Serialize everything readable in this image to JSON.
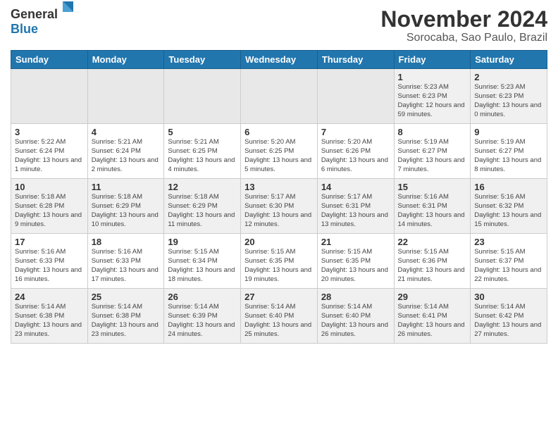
{
  "logo": {
    "general": "General",
    "blue": "Blue"
  },
  "title": {
    "month": "November 2024",
    "location": "Sorocaba, Sao Paulo, Brazil"
  },
  "days_of_week": [
    "Sunday",
    "Monday",
    "Tuesday",
    "Wednesday",
    "Thursday",
    "Friday",
    "Saturday"
  ],
  "weeks": [
    [
      {
        "day": "",
        "empty": true
      },
      {
        "day": "",
        "empty": true
      },
      {
        "day": "",
        "empty": true
      },
      {
        "day": "",
        "empty": true
      },
      {
        "day": "",
        "empty": true
      },
      {
        "day": "1",
        "sunrise": "Sunrise: 5:23 AM",
        "sunset": "Sunset: 6:23 PM",
        "daylight": "Daylight: 12 hours and 59 minutes."
      },
      {
        "day": "2",
        "sunrise": "Sunrise: 5:23 AM",
        "sunset": "Sunset: 6:23 PM",
        "daylight": "Daylight: 13 hours and 0 minutes."
      }
    ],
    [
      {
        "day": "3",
        "sunrise": "Sunrise: 5:22 AM",
        "sunset": "Sunset: 6:24 PM",
        "daylight": "Daylight: 13 hours and 1 minute."
      },
      {
        "day": "4",
        "sunrise": "Sunrise: 5:21 AM",
        "sunset": "Sunset: 6:24 PM",
        "daylight": "Daylight: 13 hours and 2 minutes."
      },
      {
        "day": "5",
        "sunrise": "Sunrise: 5:21 AM",
        "sunset": "Sunset: 6:25 PM",
        "daylight": "Daylight: 13 hours and 4 minutes."
      },
      {
        "day": "6",
        "sunrise": "Sunrise: 5:20 AM",
        "sunset": "Sunset: 6:25 PM",
        "daylight": "Daylight: 13 hours and 5 minutes."
      },
      {
        "day": "7",
        "sunrise": "Sunrise: 5:20 AM",
        "sunset": "Sunset: 6:26 PM",
        "daylight": "Daylight: 13 hours and 6 minutes."
      },
      {
        "day": "8",
        "sunrise": "Sunrise: 5:19 AM",
        "sunset": "Sunset: 6:27 PM",
        "daylight": "Daylight: 13 hours and 7 minutes."
      },
      {
        "day": "9",
        "sunrise": "Sunrise: 5:19 AM",
        "sunset": "Sunset: 6:27 PM",
        "daylight": "Daylight: 13 hours and 8 minutes."
      }
    ],
    [
      {
        "day": "10",
        "sunrise": "Sunrise: 5:18 AM",
        "sunset": "Sunset: 6:28 PM",
        "daylight": "Daylight: 13 hours and 9 minutes."
      },
      {
        "day": "11",
        "sunrise": "Sunrise: 5:18 AM",
        "sunset": "Sunset: 6:29 PM",
        "daylight": "Daylight: 13 hours and 10 minutes."
      },
      {
        "day": "12",
        "sunrise": "Sunrise: 5:18 AM",
        "sunset": "Sunset: 6:29 PM",
        "daylight": "Daylight: 13 hours and 11 minutes."
      },
      {
        "day": "13",
        "sunrise": "Sunrise: 5:17 AM",
        "sunset": "Sunset: 6:30 PM",
        "daylight": "Daylight: 13 hours and 12 minutes."
      },
      {
        "day": "14",
        "sunrise": "Sunrise: 5:17 AM",
        "sunset": "Sunset: 6:31 PM",
        "daylight": "Daylight: 13 hours and 13 minutes."
      },
      {
        "day": "15",
        "sunrise": "Sunrise: 5:16 AM",
        "sunset": "Sunset: 6:31 PM",
        "daylight": "Daylight: 13 hours and 14 minutes."
      },
      {
        "day": "16",
        "sunrise": "Sunrise: 5:16 AM",
        "sunset": "Sunset: 6:32 PM",
        "daylight": "Daylight: 13 hours and 15 minutes."
      }
    ],
    [
      {
        "day": "17",
        "sunrise": "Sunrise: 5:16 AM",
        "sunset": "Sunset: 6:33 PM",
        "daylight": "Daylight: 13 hours and 16 minutes."
      },
      {
        "day": "18",
        "sunrise": "Sunrise: 5:16 AM",
        "sunset": "Sunset: 6:33 PM",
        "daylight": "Daylight: 13 hours and 17 minutes."
      },
      {
        "day": "19",
        "sunrise": "Sunrise: 5:15 AM",
        "sunset": "Sunset: 6:34 PM",
        "daylight": "Daylight: 13 hours and 18 minutes."
      },
      {
        "day": "20",
        "sunrise": "Sunrise: 5:15 AM",
        "sunset": "Sunset: 6:35 PM",
        "daylight": "Daylight: 13 hours and 19 minutes."
      },
      {
        "day": "21",
        "sunrise": "Sunrise: 5:15 AM",
        "sunset": "Sunset: 6:35 PM",
        "daylight": "Daylight: 13 hours and 20 minutes."
      },
      {
        "day": "22",
        "sunrise": "Sunrise: 5:15 AM",
        "sunset": "Sunset: 6:36 PM",
        "daylight": "Daylight: 13 hours and 21 minutes."
      },
      {
        "day": "23",
        "sunrise": "Sunrise: 5:15 AM",
        "sunset": "Sunset: 6:37 PM",
        "daylight": "Daylight: 13 hours and 22 minutes."
      }
    ],
    [
      {
        "day": "24",
        "sunrise": "Sunrise: 5:14 AM",
        "sunset": "Sunset: 6:38 PM",
        "daylight": "Daylight: 13 hours and 23 minutes."
      },
      {
        "day": "25",
        "sunrise": "Sunrise: 5:14 AM",
        "sunset": "Sunset: 6:38 PM",
        "daylight": "Daylight: 13 hours and 23 minutes."
      },
      {
        "day": "26",
        "sunrise": "Sunrise: 5:14 AM",
        "sunset": "Sunset: 6:39 PM",
        "daylight": "Daylight: 13 hours and 24 minutes."
      },
      {
        "day": "27",
        "sunrise": "Sunrise: 5:14 AM",
        "sunset": "Sunset: 6:40 PM",
        "daylight": "Daylight: 13 hours and 25 minutes."
      },
      {
        "day": "28",
        "sunrise": "Sunrise: 5:14 AM",
        "sunset": "Sunset: 6:40 PM",
        "daylight": "Daylight: 13 hours and 26 minutes."
      },
      {
        "day": "29",
        "sunrise": "Sunrise: 5:14 AM",
        "sunset": "Sunset: 6:41 PM",
        "daylight": "Daylight: 13 hours and 26 minutes."
      },
      {
        "day": "30",
        "sunrise": "Sunrise: 5:14 AM",
        "sunset": "Sunset: 6:42 PM",
        "daylight": "Daylight: 13 hours and 27 minutes."
      }
    ]
  ]
}
